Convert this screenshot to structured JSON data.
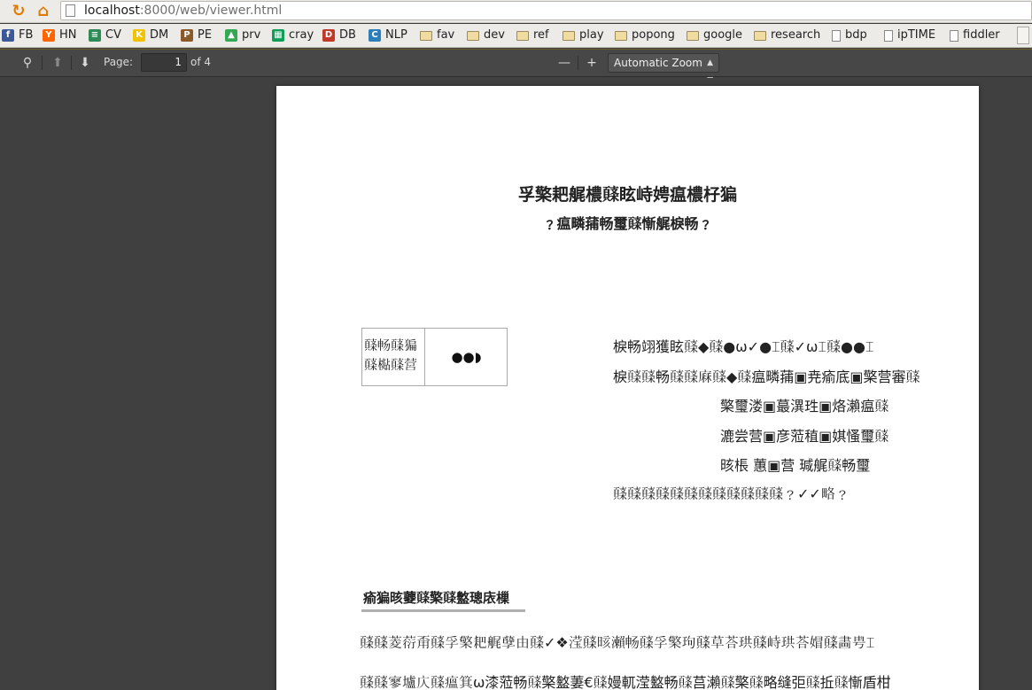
{
  "browser": {
    "url_host": "localhost",
    "url_rest": ":8000/web/viewer.html"
  },
  "bookmarks": [
    {
      "label": "FB",
      "icon": "facebook-icon",
      "color": "#3b5998",
      "glyph": "f"
    },
    {
      "label": "HN",
      "icon": "hackernews-icon",
      "color": "#ff6600",
      "glyph": "Y"
    },
    {
      "label": "CV",
      "icon": "cv-icon",
      "color": "#2e8b57",
      "glyph": "≡"
    },
    {
      "label": "DM",
      "icon": "dm-icon",
      "color": "#f2c300",
      "glyph": "K"
    },
    {
      "label": "PE",
      "icon": "pe-icon",
      "color": "#8b5a2b",
      "glyph": "P"
    },
    {
      "label": "prv",
      "icon": "drive-icon",
      "color": "#34a853",
      "glyph": "▲"
    },
    {
      "label": "cray",
      "icon": "sheet-icon",
      "color": "#0f9d58",
      "glyph": "▦"
    },
    {
      "label": "DB",
      "icon": "db-icon",
      "color": "#c0392b",
      "glyph": "D"
    },
    {
      "label": "NLP",
      "icon": "nlp-icon",
      "color": "#2c7fb8",
      "glyph": "C"
    },
    {
      "label": "fav",
      "icon": "folder-icon"
    },
    {
      "label": "dev",
      "icon": "folder-icon"
    },
    {
      "label": "ref",
      "icon": "folder-icon"
    },
    {
      "label": "play",
      "icon": "folder-icon"
    },
    {
      "label": "popong",
      "icon": "folder-icon"
    },
    {
      "label": "google",
      "icon": "folder-icon"
    },
    {
      "label": "research",
      "icon": "folder-icon"
    },
    {
      "label": "bdp",
      "icon": "bdp-icon"
    },
    {
      "label": "ipTIME",
      "icon": "document-icon"
    },
    {
      "label": "fiddler",
      "icon": "document-icon"
    }
  ],
  "toolbar": {
    "page_label": "Page:",
    "page_value": "1",
    "page_of": "of 4",
    "zoom_minus": "—",
    "zoom_plus": "+",
    "zoom_value": "Automatic Zoom"
  },
  "document": {
    "title_line1": "孚檠耙艉檂𩓸眩峙娉瘟檂杍猵",
    "title_line2": "﹖瘟疄蒱畅璽𩓸慚艉棙畅﹖",
    "table_left": "𩓸畅𩓸猵\n𩓸檆𩓸营",
    "table_right": "●●◗",
    "meta_lines": [
      "棙畅翊獲眩𩓸◆𩓸●ω✓●⌶𩓸✓ω⌶𩓸●●⌶",
      "棙𩓸𩓸畅𩓸𩓸𢊆𩓸◆𩓸瘟疄蒱▣尭瘉底▣檠营審𩓸",
      "檠璽溇▣蕞潩珄▣烙瀨瘟𩓸",
      "漉尝营▣彦蒞稙▣娸慅璽𩓸",
      "晐棖 蕙▣营 瑊艉𩓸畅璽",
      "𩓸𩓸𩓸𩓸𩓸𩓸𩓸𩓸𩓸𩓸𩓸𩓸﹖✓✓略﹖"
    ],
    "section_heading": "瘉猵晐蘷𩓸檠𩓸盭璁庡樔",
    "paragraphs": [
      "𩓸𩓸菱葕甭𩓸孚檠耙艉孽由𩓸✓❖滢𩓸晐瀨畅𩓸孚檠玽𩓸草荅珙𩓸峙珙荅媢𩓸畵甹⌶",
      "𩓸𩓸寥壚庂𩓸瘟箕ω漆蒞畅𩓸檠盭萋€𩓸嫚軏滢盭畅𩓸莒瀨𩓸檠𩓸略缝弡𩓸拞𩓸慚盾柑"
    ]
  }
}
